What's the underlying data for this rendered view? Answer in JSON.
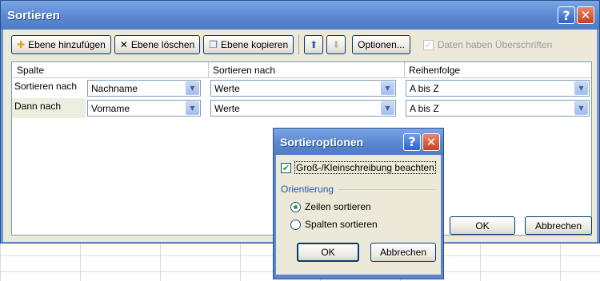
{
  "window": {
    "title": "Sortieren"
  },
  "toolbar": {
    "add_level": "Ebene hinzufügen",
    "delete_level": "Ebene löschen",
    "copy_level": "Ebene kopieren",
    "options": "Optionen...",
    "headers_checkbox": "Daten haben Überschriften"
  },
  "grid": {
    "headers": [
      "Spalte",
      "Sortieren nach",
      "Reihenfolge"
    ],
    "rows": [
      {
        "label": "Sortieren nach",
        "column": "Nachname",
        "sort_on": "Werte",
        "order": "A bis Z"
      },
      {
        "label": "Dann nach",
        "column": "Vorname",
        "sort_on": "Werte",
        "order": "A bis Z"
      }
    ]
  },
  "main_buttons": {
    "ok": "OK",
    "cancel": "Abbrechen"
  },
  "sub_dialog": {
    "title": "Sortieroptionen",
    "case_checkbox": "Groß-/Kleinschreibung beachten",
    "orientation_group": "Orientierung",
    "radio_rows": "Zeilen sortieren",
    "radio_columns": "Spalten sortieren",
    "ok": "OK",
    "cancel": "Abbrechen"
  },
  "colors": {
    "title_bar": "#5a87cf",
    "dialog_bg": "#ece9d8",
    "accent": "#1e5aa8"
  }
}
